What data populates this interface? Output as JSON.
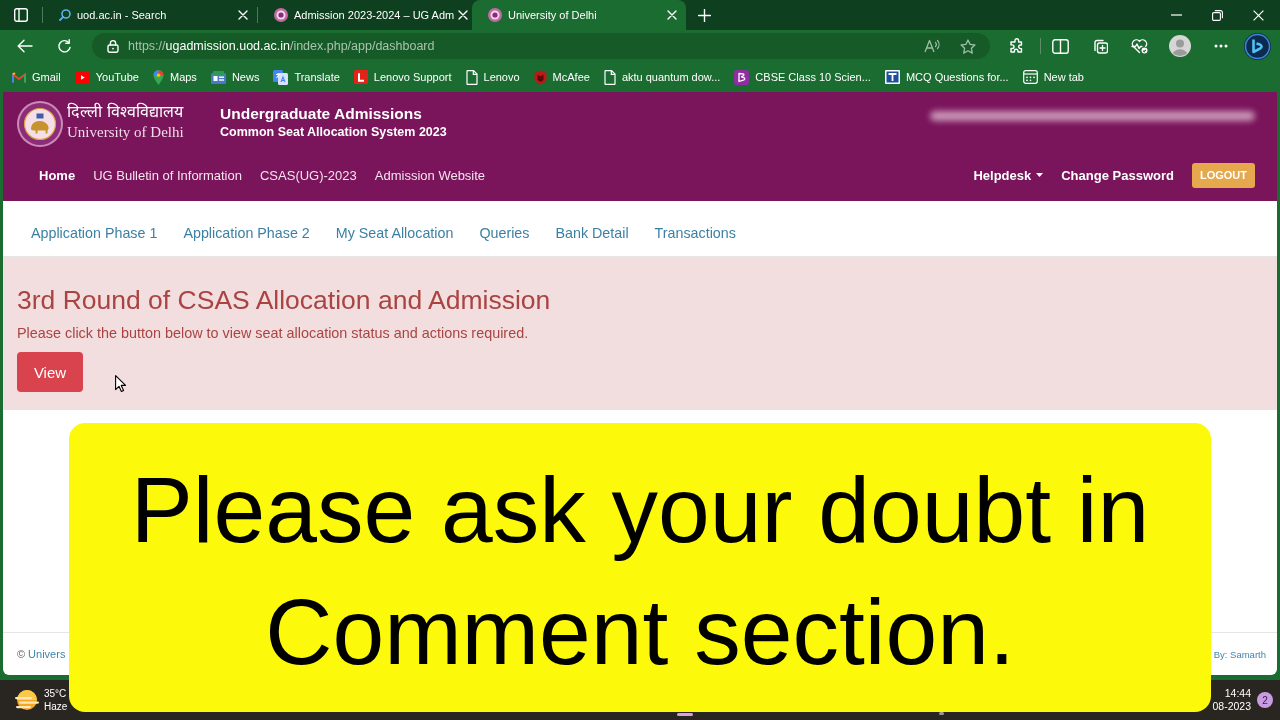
{
  "browser": {
    "tabs": [
      {
        "title": "uod.ac.in - Search",
        "kind": "search",
        "selected": false
      },
      {
        "title": "Admission 2023-2024 – UG Adm",
        "kind": "site",
        "selected": false
      },
      {
        "title": "University of Delhi",
        "kind": "site",
        "selected": true
      }
    ],
    "url": {
      "scheme": "https://",
      "host": "ugadmission.uod.ac.in",
      "path": "/index.php/app/dashboard"
    },
    "bookmarks": [
      {
        "label": "Gmail",
        "kind": "mail"
      },
      {
        "label": "YouTube",
        "kind": "video"
      },
      {
        "label": "Maps",
        "kind": "map"
      },
      {
        "label": "News",
        "kind": "news"
      },
      {
        "label": "Translate",
        "kind": "translate"
      },
      {
        "label": "Lenovo Support",
        "kind": "red-tile"
      },
      {
        "label": "Lenovo",
        "kind": "page"
      },
      {
        "label": "McAfee",
        "kind": "shield"
      },
      {
        "label": "aktu quantum dow...",
        "kind": "page"
      },
      {
        "label": "CBSE Class 10 Scien...",
        "kind": "purple-tile"
      },
      {
        "label": "MCQ Questions for...",
        "kind": "blue-tile"
      },
      {
        "label": "New tab",
        "kind": "grid-page"
      }
    ]
  },
  "site": {
    "logo": {
      "hindi": "दिल्ली विश्वविद्यालय",
      "english": "University of Delhi"
    },
    "title": "Undergraduate Admissions",
    "subtitle": "Common Seat Allocation System 2023",
    "nav": [
      {
        "label": "Home",
        "selected": true
      },
      {
        "label": "UG Bulletin of Information",
        "selected": false
      },
      {
        "label": "CSAS(UG)-2023",
        "selected": false
      },
      {
        "label": "Admission Website",
        "selected": false
      }
    ],
    "helpdesk": "Helpdesk",
    "change_password": "Change Password",
    "logout": "LOGOUT",
    "tabs": [
      "Application Phase 1",
      "Application Phase 2",
      "My Seat Allocation",
      "Queries",
      "Bank Detail",
      "Transactions"
    ],
    "alert": {
      "heading": "3rd Round of CSAS Allocation and Admission",
      "text": "Please click the button below to view seat allocation status and actions required.",
      "button": "View"
    },
    "footer": {
      "copyright": "©",
      "link": "Univers",
      "credit": "By: Samarth"
    }
  },
  "caption": {
    "text": "Please ask your doubt in Comment section."
  },
  "taskbar": {
    "temperature": "35°C",
    "condition": "Haze",
    "time": "14:44",
    "date": "08-2023",
    "notifications": "2"
  }
}
